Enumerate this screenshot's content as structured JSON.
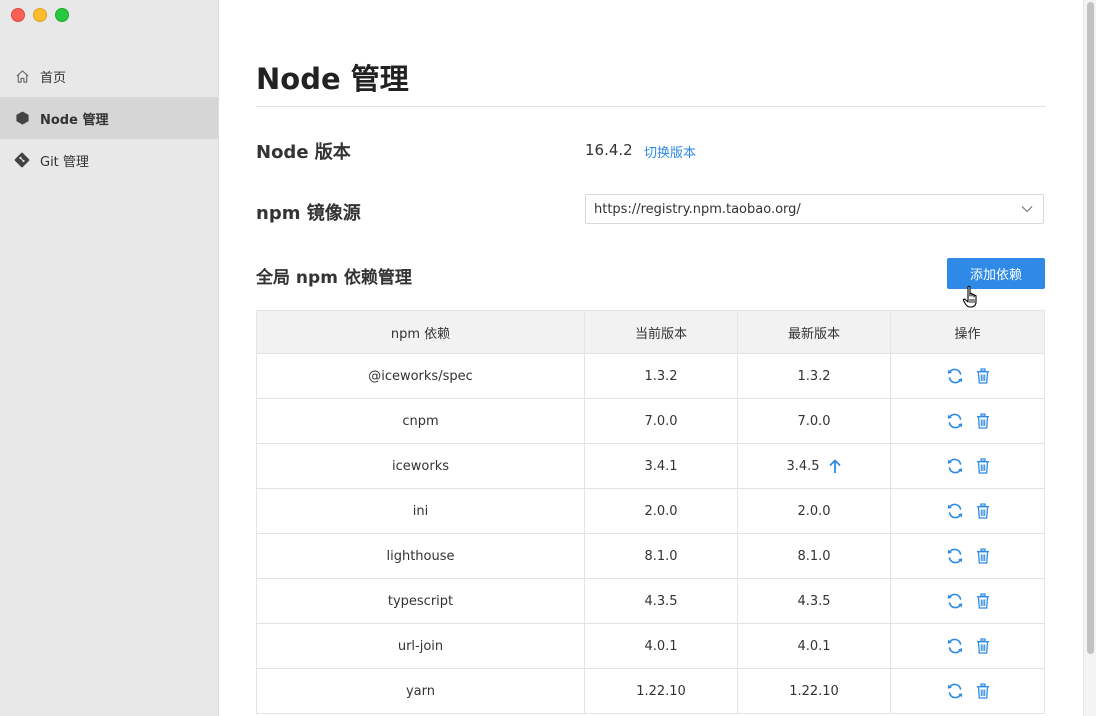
{
  "sidebar": {
    "items": [
      {
        "label": "首页",
        "icon": "home-icon",
        "active": false
      },
      {
        "label": "Node 管理",
        "icon": "node-icon",
        "active": true
      },
      {
        "label": "Git 管理",
        "icon": "git-icon",
        "active": false
      }
    ]
  },
  "page": {
    "title": "Node 管理",
    "node_version_label": "Node 版本",
    "node_version_value": "16.4.2",
    "switch_version_link": "切换版本",
    "npm_registry_label": "npm 镜像源",
    "npm_registry_value": "https://registry.npm.taobao.org/",
    "deps_section_title": "全局 npm 依赖管理",
    "add_dependency_button": "添加依赖"
  },
  "table": {
    "headers": [
      "npm 依赖",
      "当前版本",
      "最新版本",
      "操作"
    ],
    "rows": [
      {
        "name": "@iceworks/spec",
        "current": "1.3.2",
        "latest": "1.3.2",
        "upgradable": false
      },
      {
        "name": "cnpm",
        "current": "7.0.0",
        "latest": "7.0.0",
        "upgradable": false
      },
      {
        "name": "iceworks",
        "current": "3.4.1",
        "latest": "3.4.5",
        "upgradable": true
      },
      {
        "name": "ini",
        "current": "2.0.0",
        "latest": "2.0.0",
        "upgradable": false
      },
      {
        "name": "lighthouse",
        "current": "8.1.0",
        "latest": "8.1.0",
        "upgradable": false
      },
      {
        "name": "typescript",
        "current": "4.3.5",
        "latest": "4.3.5",
        "upgradable": false
      },
      {
        "name": "url-join",
        "current": "4.0.1",
        "latest": "4.0.1",
        "upgradable": false
      },
      {
        "name": "yarn",
        "current": "1.22.10",
        "latest": "1.22.10",
        "upgradable": false
      }
    ]
  },
  "colors": {
    "accent": "#2e8ae6",
    "sidebar_bg": "#e8e8e8",
    "sidebar_active": "#d6d6d6"
  }
}
